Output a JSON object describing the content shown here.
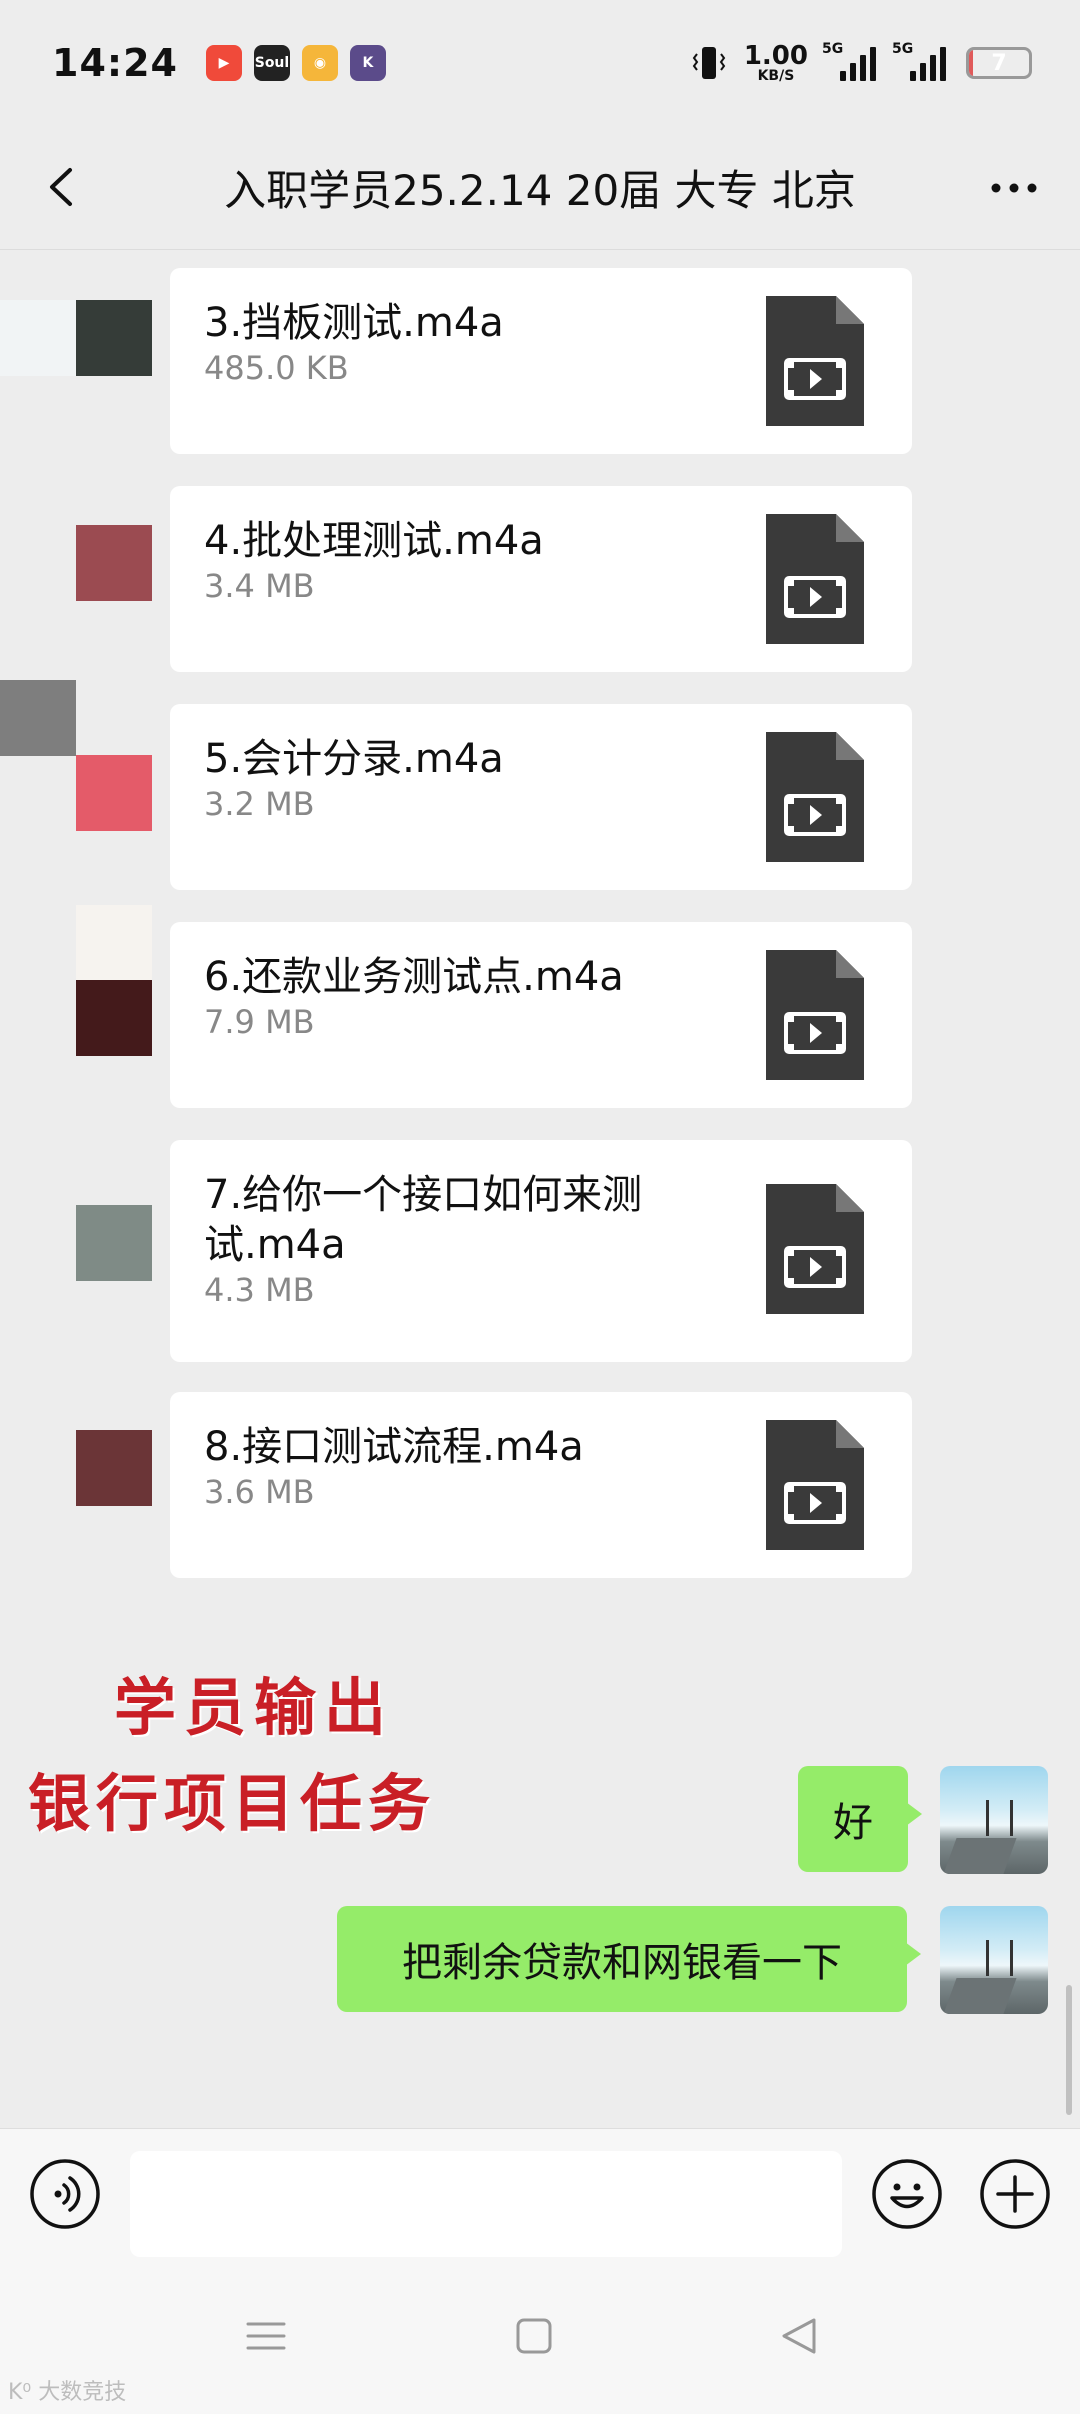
{
  "status_bar": {
    "time": "14:24",
    "app_icons": [
      {
        "name": "video-app-icon",
        "color": "#f04a3a",
        "label": ""
      },
      {
        "name": "soul-app-icon",
        "color": "#222222",
        "label": "Soul"
      },
      {
        "name": "weibo-icon",
        "color": "#f5b63a",
        "label": ""
      },
      {
        "name": "k-app-icon",
        "color": "#5b4b8a",
        "label": "K"
      }
    ],
    "net_speed": "1.00",
    "net_unit": "KB/S",
    "signal_1": "5G",
    "signal_2": "5G",
    "battery": "7",
    "battery_level_fraction": 0.07,
    "battery_color": "#e05a5a"
  },
  "header": {
    "title": "入职学员25.2.14 20届 大专 北京"
  },
  "files": [
    {
      "name": "3.挡板测试.m4a",
      "size": "485.0 KB"
    },
    {
      "name": "4.批处理测试.m4a",
      "size": "3.4 MB"
    },
    {
      "name": "5.会计分录.m4a",
      "size": "3.2 MB"
    },
    {
      "name": "6.还款业务测试点.m4a",
      "size": "7.9 MB"
    },
    {
      "name": "7.给你一个接口如何来测试.m4a",
      "size": "4.3 MB"
    },
    {
      "name": "8.接口测试流程.m4a",
      "size": "3.6 MB"
    }
  ],
  "watermark": {
    "line1": "学员输出",
    "line2": "银行项目任务",
    "color": "#c91f26"
  },
  "messages": [
    {
      "text": "好",
      "from": "me"
    },
    {
      "text": "把剩余贷款和网银看一下",
      "from": "me"
    }
  ],
  "colors": {
    "background": "#ededed",
    "bubble": "#95ec69",
    "file_icon": "#3a3a3a"
  },
  "corner_mark": "K⁰ 大数竞技"
}
